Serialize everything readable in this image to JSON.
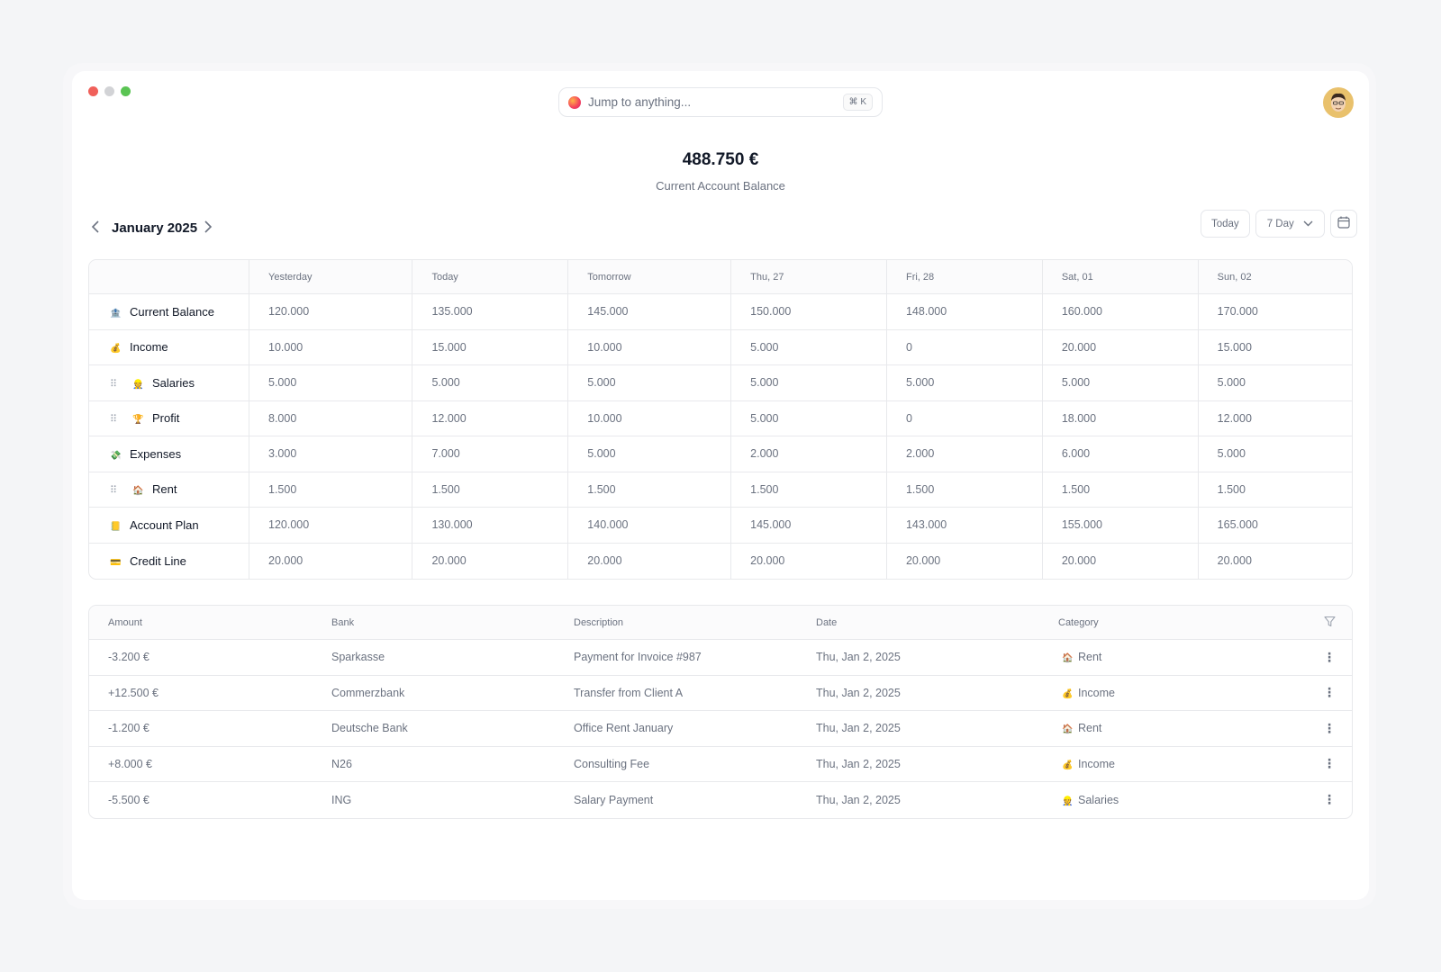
{
  "colors": {
    "page_bg": "#f4f5f7",
    "window_bg": "#ffffff",
    "border": "#e8e9ec",
    "text_primary": "#111827",
    "text_muted": "#6b7280",
    "traffic_red": "#f0605a",
    "traffic_gray": "#d2d3d6",
    "traffic_green": "#5ac453"
  },
  "search": {
    "placeholder": "Jump to anything...",
    "shortcut": "⌘ K",
    "icon": "app-logo-icon"
  },
  "avatar": {
    "icon": "user-avatar-icon"
  },
  "balance": {
    "amount": "488.750 €",
    "label": "Current Account Balance"
  },
  "nav": {
    "month": "January 2025"
  },
  "controls": {
    "today": "Today",
    "range": "7 Day",
    "calendar_icon": "calendar-icon"
  },
  "grid": {
    "columns": [
      "Yesterday",
      "Today",
      "Tomorrow",
      "Thu, 27",
      "Fri, 28",
      "Sat, 01",
      "Sun, 02"
    ],
    "rows": [
      {
        "label": "Current Balance",
        "emoji": "🏦",
        "child": false,
        "values": [
          "120.000",
          "135.000",
          "145.000",
          "150.000",
          "148.000",
          "160.000",
          "170.000"
        ]
      },
      {
        "label": "Income",
        "emoji": "💰",
        "child": false,
        "values": [
          "10.000",
          "15.000",
          "10.000",
          "5.000",
          "0",
          "20.000",
          "15.000"
        ]
      },
      {
        "label": "Salaries",
        "emoji": "👷",
        "child": true,
        "values": [
          "5.000",
          "5.000",
          "5.000",
          "5.000",
          "5.000",
          "5.000",
          "5.000"
        ]
      },
      {
        "label": "Profit",
        "emoji": "🏆",
        "child": true,
        "values": [
          "8.000",
          "12.000",
          "10.000",
          "5.000",
          "0",
          "18.000",
          "12.000"
        ]
      },
      {
        "label": "Expenses",
        "emoji": "💸",
        "child": false,
        "values": [
          "3.000",
          "7.000",
          "5.000",
          "2.000",
          "2.000",
          "6.000",
          "5.000"
        ]
      },
      {
        "label": "Rent",
        "emoji": "🏠",
        "child": true,
        "values": [
          "1.500",
          "1.500",
          "1.500",
          "1.500",
          "1.500",
          "1.500",
          "1.500"
        ]
      },
      {
        "label": "Account Plan",
        "emoji": "📒",
        "child": false,
        "values": [
          "120.000",
          "130.000",
          "140.000",
          "145.000",
          "143.000",
          "155.000",
          "165.000"
        ]
      },
      {
        "label": "Credit Line",
        "emoji": "💳",
        "child": false,
        "values": [
          "20.000",
          "20.000",
          "20.000",
          "20.000",
          "20.000",
          "20.000",
          "20.000"
        ]
      }
    ]
  },
  "transactions": {
    "headers": {
      "amount": "Amount",
      "bank": "Bank",
      "description": "Description",
      "date": "Date",
      "category": "Category"
    },
    "rows": [
      {
        "amount": "-3.200 €",
        "bank": "Sparkasse",
        "description": "Payment for Invoice #987",
        "date": "Thu, Jan 2, 2025",
        "category": "Rent",
        "emoji": "🏠"
      },
      {
        "amount": "+12.500 €",
        "bank": "Commerzbank",
        "description": "Transfer from Client A",
        "date": "Thu, Jan 2, 2025",
        "category": "Income",
        "emoji": "💰"
      },
      {
        "amount": "-1.200 €",
        "bank": "Deutsche Bank",
        "description": "Office Rent January",
        "date": "Thu, Jan 2, 2025",
        "category": "Rent",
        "emoji": "🏠"
      },
      {
        "amount": "+8.000 €",
        "bank": "N26",
        "description": "Consulting Fee",
        "date": "Thu, Jan 2, 2025",
        "category": "Income",
        "emoji": "💰"
      },
      {
        "amount": "-5.500 €",
        "bank": "ING",
        "description": "Salary Payment",
        "date": "Thu, Jan 2, 2025",
        "category": "Salaries",
        "emoji": "👷"
      }
    ]
  }
}
